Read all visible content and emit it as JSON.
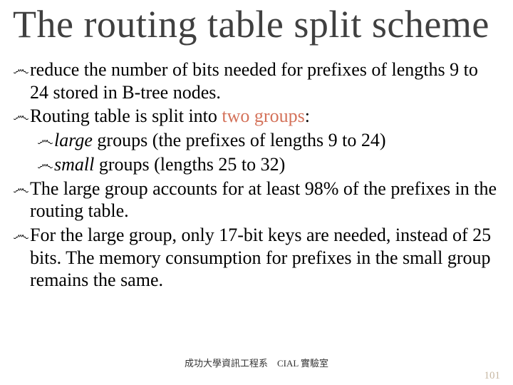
{
  "title": "The routing table split scheme",
  "bullets": [
    {
      "text": "reduce the number of bits needed for prefixes of lengths 9 to 24 stored in B-tree nodes."
    },
    {
      "pre": "Routing table is split into ",
      "accent": "two groups",
      "post": ":",
      "subs": [
        {
          "italic": "large",
          "rest": " groups (the prefixes of lengths 9 to 24)"
        },
        {
          "italic": "small",
          "rest": " groups (lengths 25 to 32)"
        }
      ]
    },
    {
      "text": "The large group accounts for at least 98% of the prefixes in the routing table."
    },
    {
      "text": "For the large group, only 17-bit keys are needed, instead of 25 bits. The memory consumption for prefixes in the small group remains the same."
    }
  ],
  "footer": "成功大學資訊工程系　CIAL 實驗室",
  "page": "101",
  "icon": "෴"
}
